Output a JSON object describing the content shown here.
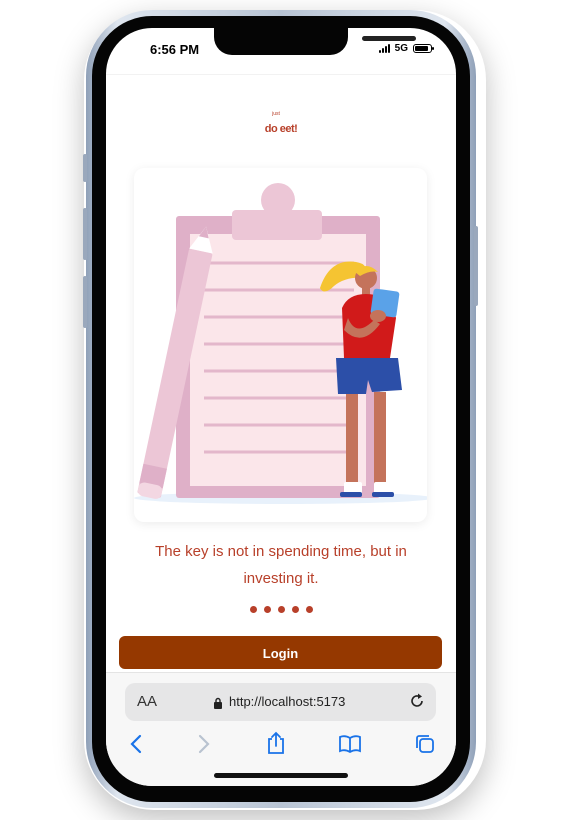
{
  "status_bar": {
    "time": "6:56 PM",
    "network": "5G"
  },
  "app": {
    "logo_small": "just",
    "logo_main": "do eet!",
    "quote": "The key is not in spending time, but in investing it.",
    "carousel": {
      "total": 5,
      "active": 1
    },
    "login_label": "Login"
  },
  "browser": {
    "text_size_label": "AA",
    "url": "http://localhost:5173",
    "toolbar": [
      "back-icon",
      "forward-icon",
      "share-icon",
      "bookmarks-icon",
      "tabs-icon"
    ]
  },
  "colors": {
    "accent": "#b8402a",
    "button": "#953800",
    "browser_blue": "#1a73e8"
  }
}
